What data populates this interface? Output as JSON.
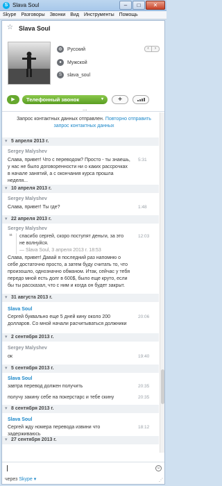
{
  "window": {
    "title": "Slava Soul",
    "min": "–",
    "max": "□",
    "close": "✕",
    "app_icon": "S"
  },
  "menu": [
    "Skype",
    "Разговоры",
    "Звонки",
    "Вид",
    "Инструменты",
    "Помощь"
  ],
  "contact": {
    "name": "Slava Soul",
    "language": "Русский",
    "gender": "Мужской",
    "skype": "slava_soul"
  },
  "nav": {
    "prev": "‹",
    "next": "›"
  },
  "actions": {
    "video": "▶",
    "call_label": "Телефонный звонок",
    "call_arrow": "▾",
    "add": "+",
    "more": "..."
  },
  "notice": {
    "text": "Запрос контактных данных отправлен. ",
    "link": "Повторно отправить запрос контактных данных"
  },
  "chat": {
    "dates": [
      "5 апреля 2013 г.",
      "10 апреля 2013 г.",
      "22 апреля 2013 г.",
      "31 августа 2013 г.",
      "2 сентября 2013 г.",
      "5 сентября 2013 г.",
      "8 сентября 2013 г.",
      "27 сентября 2013 г."
    ],
    "senders": {
      "sergey": "Sergey Malyshev",
      "slava": "Slava Soul"
    },
    "messages": [
      {
        "text": "Слава, привет! Что с переводом? Просто - ты знаешь, у нас не было договоренности ни о каких рассрочках в начале занятий, а с окончания курса прошла неделя...",
        "time": "5:31"
      },
      {
        "text": "Слава, привет! Ты где?",
        "time": "1:48"
      },
      {
        "text": "спасибо сергей, скоро поступят деньги, за это не волнуйся.",
        "time": "12:03",
        "quote_src": "— Slava Soul, 3 апреля 2013 г. 18:53"
      },
      {
        "text": "Слава, привет! Давай я последний раз напомню о себе достаточно просто, а затем буду считать то, что произошло, однозначно обманом. Итак, сейчас у тебя передо мной есть долг в 600$, было еще круто, если бы ты рассказал, что с ним и когда он будет закрыт."
      },
      {
        "text": "Сергей буквально еще 5 дней кину около 200 долларов. Со мной начали расчитываться должники",
        "time": "20:06"
      },
      {
        "text": "ок",
        "time": "19:40"
      },
      {
        "text": "завтра перевод должен получить",
        "time": "20:35"
      },
      {
        "text": "получу закину себе на покерстарс и тебе скину",
        "time": "20:35"
      },
      {
        "text": "Сергей жду номера перевода извини что задерживаюсь",
        "time": "18:12"
      }
    ]
  },
  "footer": {
    "via": "через",
    "via_link": "Skype ▾"
  }
}
